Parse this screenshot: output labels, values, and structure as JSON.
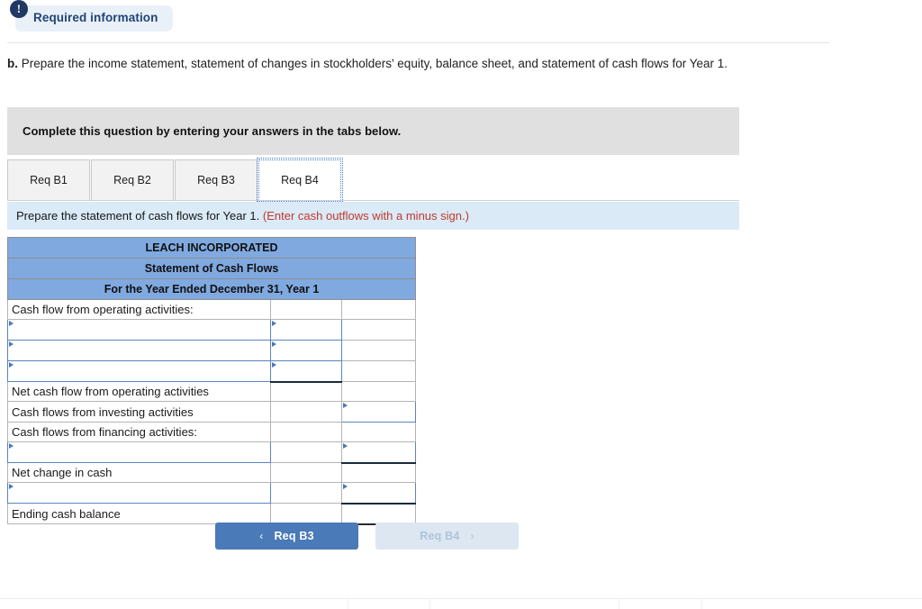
{
  "badge": {
    "icon": "exclamation-icon",
    "icon_glyph": "!",
    "label": "Required information"
  },
  "question": {
    "marker": "b.",
    "text": " Prepare the income statement, statement of changes in stockholders' equity, balance sheet, and statement of cash flows for Year 1."
  },
  "grey_banner": {
    "text": "Complete this question by entering your answers in the tabs below."
  },
  "tabs": {
    "items": [
      {
        "label": "Req B1",
        "active": false
      },
      {
        "label": "Req B2",
        "active": false
      },
      {
        "label": "Req B3",
        "active": false
      },
      {
        "label": "Req B4",
        "active": true
      }
    ]
  },
  "instruction": {
    "main": "Prepare the statement of cash flows for Year 1. ",
    "note": "(Enter cash outflows with a minus sign.)"
  },
  "statement": {
    "header": {
      "company": "LEACH INCORPORATED",
      "title": "Statement of Cash Flows",
      "period": "For the Year Ended December 31, Year 1"
    },
    "rows": [
      {
        "label": "Cash flow from operating activities:",
        "mid": "",
        "right": ""
      },
      {
        "label": "",
        "mid": "",
        "right": ""
      },
      {
        "label": "",
        "mid": "",
        "right": ""
      },
      {
        "label": "",
        "mid": "",
        "right": ""
      },
      {
        "label": "Net cash flow from operating activities",
        "mid": "",
        "right": ""
      },
      {
        "label": "Cash flows from investing activities",
        "mid": "",
        "right": ""
      },
      {
        "label": "Cash flows from financing activities:",
        "mid": "",
        "right": ""
      },
      {
        "label": "",
        "mid": "",
        "right": ""
      },
      {
        "label": "Net change in cash",
        "mid": "",
        "right": ""
      },
      {
        "label": "",
        "mid": "",
        "right": ""
      },
      {
        "label": "Ending cash balance",
        "mid": "",
        "right": ""
      }
    ]
  },
  "nav": {
    "prev_label": "Req B3",
    "prev_chevron": "‹",
    "next_label": "Req B4",
    "next_chevron": "›"
  },
  "colors": {
    "table_header_blue": "#80a9e0",
    "instruction_blue": "#dbeaf7",
    "grey_banner": "#e0e0e0",
    "nav_active": "#4a7ab8",
    "nav_disabled": "#dce7f2",
    "badge_navy": "#1f3864",
    "note_red": "#c0392b",
    "input_border": "#5b84bd"
  }
}
